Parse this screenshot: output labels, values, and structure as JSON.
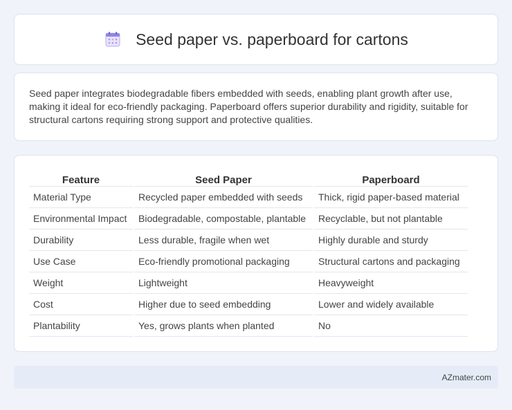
{
  "header": {
    "title": "Seed paper vs. paperboard for cartons",
    "icon": "calendar-icon"
  },
  "description": "Seed paper integrates biodegradable fibers embedded with seeds, enabling plant growth after use, making it ideal for eco-friendly packaging. Paperboard offers superior durability and rigidity, suitable for structural cartons requiring strong support and protective qualities.",
  "table": {
    "headers": [
      "Feature",
      "Seed Paper",
      "Paperboard"
    ],
    "rows": [
      [
        "Material Type",
        "Recycled paper embedded with seeds",
        "Thick, rigid paper-based material"
      ],
      [
        "Environmental Impact",
        "Biodegradable, compostable, plantable",
        "Recyclable, but not plantable"
      ],
      [
        "Durability",
        "Less durable, fragile when wet",
        "Highly durable and sturdy"
      ],
      [
        "Use Case",
        "Eco-friendly promotional packaging",
        "Structural cartons and packaging"
      ],
      [
        "Weight",
        "Lightweight",
        "Heavyweight"
      ],
      [
        "Cost",
        "Higher due to seed embedding",
        "Lower and widely available"
      ],
      [
        "Plantability",
        "Yes, grows plants when planted",
        "No"
      ]
    ]
  },
  "footer": {
    "brand": "AZmater.com"
  }
}
